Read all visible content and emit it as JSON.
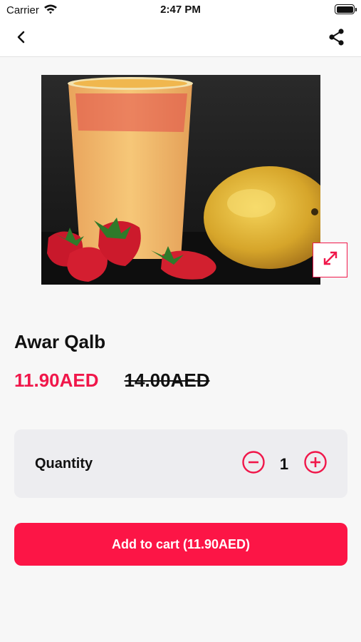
{
  "status_bar": {
    "carrier": "Carrier",
    "time": "2:47 PM"
  },
  "nav": {
    "back_icon": "chevron-left-icon",
    "share_icon": "share-icon"
  },
  "product": {
    "name": "Awar Qalb",
    "price_current": "11.90AED",
    "price_original": "14.00AED",
    "image_icon": "expand-icon"
  },
  "quantity": {
    "label": "Quantity",
    "value": "1"
  },
  "cart": {
    "button_label": "Add to cart (11.90AED)"
  },
  "colors": {
    "accent": "#f0174a",
    "button": "#fc1546"
  }
}
